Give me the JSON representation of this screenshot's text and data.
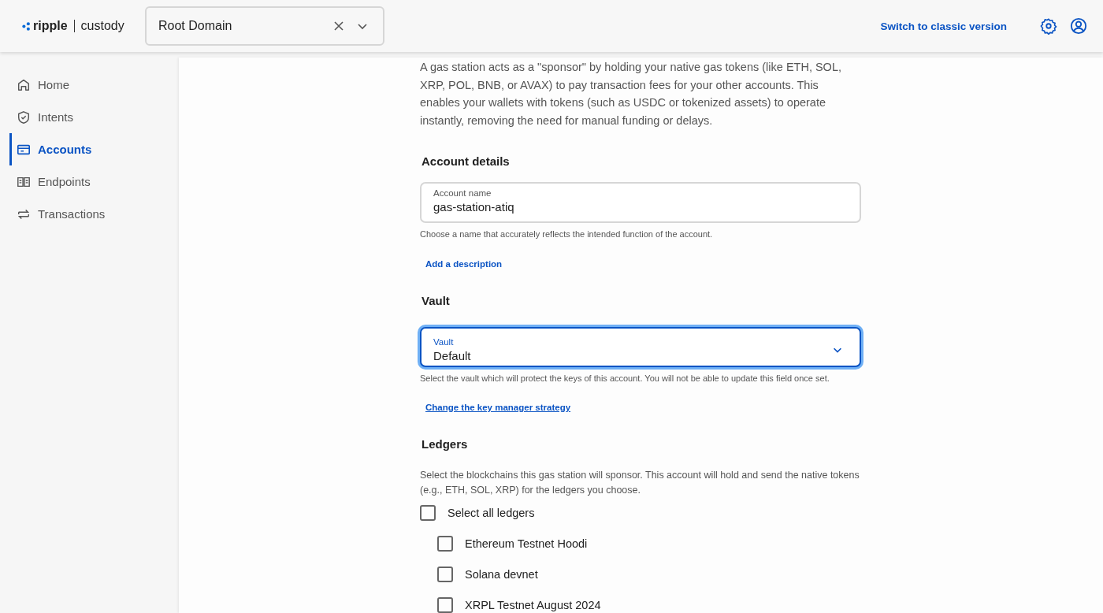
{
  "header": {
    "logo_brand": "ripple",
    "logo_product": "custody",
    "domain_select": {
      "value": "Root Domain"
    },
    "classic_link": "Switch to classic version"
  },
  "sidebar": {
    "items": [
      {
        "label": "Home",
        "kind": "home",
        "selected": false
      },
      {
        "label": "Intents",
        "kind": "shield",
        "selected": false
      },
      {
        "label": "Accounts",
        "kind": "card",
        "selected": true
      },
      {
        "label": "Endpoints",
        "kind": "book",
        "selected": false
      },
      {
        "label": "Transactions",
        "kind": "swap",
        "selected": false
      }
    ]
  },
  "form": {
    "intro": "A gas station acts as a \"sponsor\" by holding your native gas tokens (like ETH, SOL, XRP, POL, BNB, or AVAX) to pay transaction fees for your other accounts. This enables your wallets with tokens (such as USDC or tokenized assets) to operate instantly, removing the need for manual funding or delays.",
    "account_details": {
      "heading": "Account details",
      "name_field": {
        "label": "Account name",
        "value": "gas-station-atiq",
        "focused": false
      },
      "help": "Choose a name that accurately reflects the intended function of the account.",
      "add_description": "Add a description"
    },
    "vault": {
      "heading": "Vault",
      "select": {
        "label": "Vault",
        "value": "Default",
        "focused": true
      },
      "help": "Select the vault which will protect the keys of this account. You will not be able to update this field once set.",
      "strategy_link": "Change the key manager strategy"
    },
    "ledgers": {
      "heading": "Ledgers",
      "help": "Select the blockchains this gas station will sponsor. This account will hold and send the native tokens (e.g., ETH, SOL, XRP) for the ledgers you choose.",
      "select_all": {
        "label": "Select all ledgers",
        "checked": false
      },
      "items": [
        {
          "label": "Ethereum Testnet Hoodi",
          "checked": false
        },
        {
          "label": "Solana devnet",
          "checked": false
        },
        {
          "label": "XRPL Testnet August 2024",
          "checked": false
        }
      ]
    }
  }
}
